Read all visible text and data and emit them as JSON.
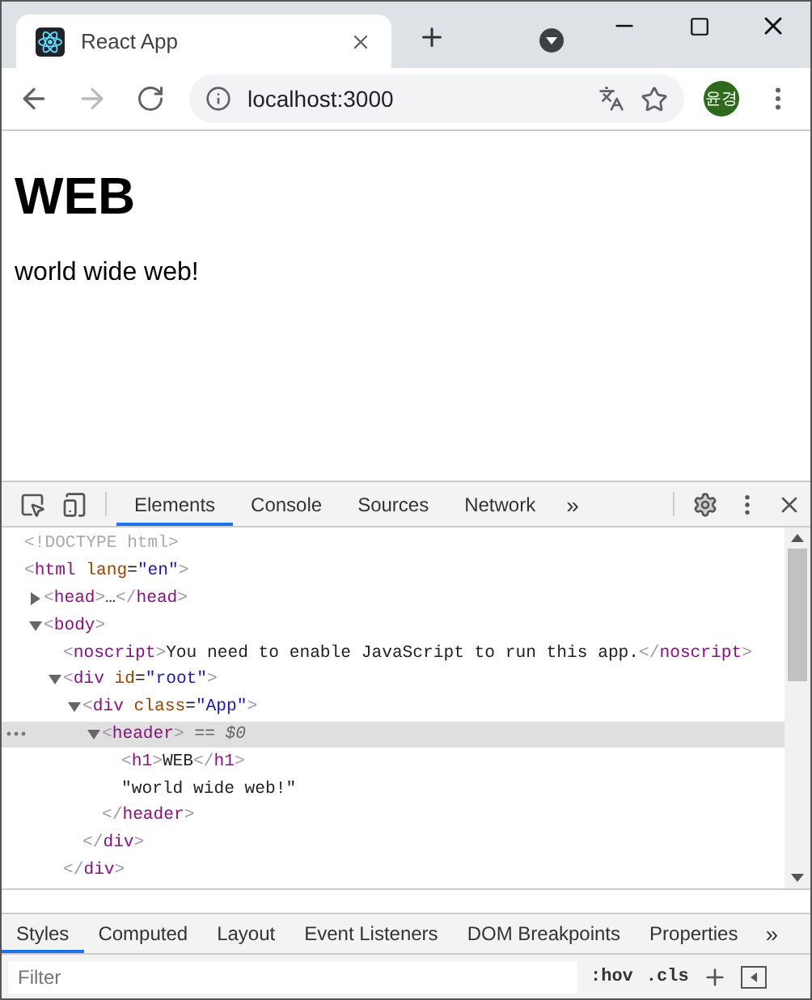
{
  "browser": {
    "tab_title": "React App",
    "address": "localhost:3000",
    "profile": "윤경"
  },
  "page": {
    "heading": "WEB",
    "text": "world wide web!"
  },
  "devtools": {
    "tabs": [
      {
        "label": "Elements",
        "selected": true
      },
      {
        "label": "Console",
        "selected": false
      },
      {
        "label": "Sources",
        "selected": false
      },
      {
        "label": "Network",
        "selected": false
      }
    ],
    "more": "»",
    "dom": [
      {
        "kind": "doctype",
        "markup": "<!DOCTYPE html>",
        "selected": false
      },
      {
        "kind": "element",
        "markup": "<html lang=\"en\">",
        "selected": false,
        "children": [
          {
            "kind": "element",
            "markup": "<head>…</head>",
            "expanded": false,
            "selected": false
          },
          {
            "kind": "element",
            "markup": "<body>",
            "expanded": true,
            "selected": false,
            "children": [
              {
                "kind": "element",
                "markup": "<noscript>You need to enable JavaScript to run this app.</noscript>",
                "selected": false
              },
              {
                "kind": "element",
                "markup": "<div id=\"root\">",
                "expanded": true,
                "selected": false,
                "closing": "</div>",
                "children": [
                  {
                    "kind": "element",
                    "markup": "<div class=\"App\">",
                    "expanded": true,
                    "selected": false,
                    "closing": "</div>",
                    "children": [
                      {
                        "kind": "element",
                        "markup": "<header>",
                        "suffix": " == $0",
                        "expanded": true,
                        "selected": true,
                        "closing": "</header>",
                        "children": [
                          {
                            "kind": "element",
                            "markup": "<h1>WEB</h1>",
                            "selected": false
                          },
                          {
                            "kind": "text",
                            "markup": "\"world wide web!\"",
                            "selected": false
                          }
                        ]
                      }
                    ]
                  }
                ]
              }
            ]
          }
        ]
      }
    ],
    "side_tabs": [
      {
        "label": "Styles",
        "selected": true
      },
      {
        "label": "Computed",
        "selected": false
      },
      {
        "label": "Layout",
        "selected": false
      },
      {
        "label": "Event Listeners",
        "selected": false
      },
      {
        "label": "DOM Breakpoints",
        "selected": false
      },
      {
        "label": "Properties",
        "selected": false
      }
    ],
    "side_more": "»",
    "filter": {
      "placeholder": "Filter",
      "hov": ":hov",
      "cls": ".cls"
    }
  }
}
